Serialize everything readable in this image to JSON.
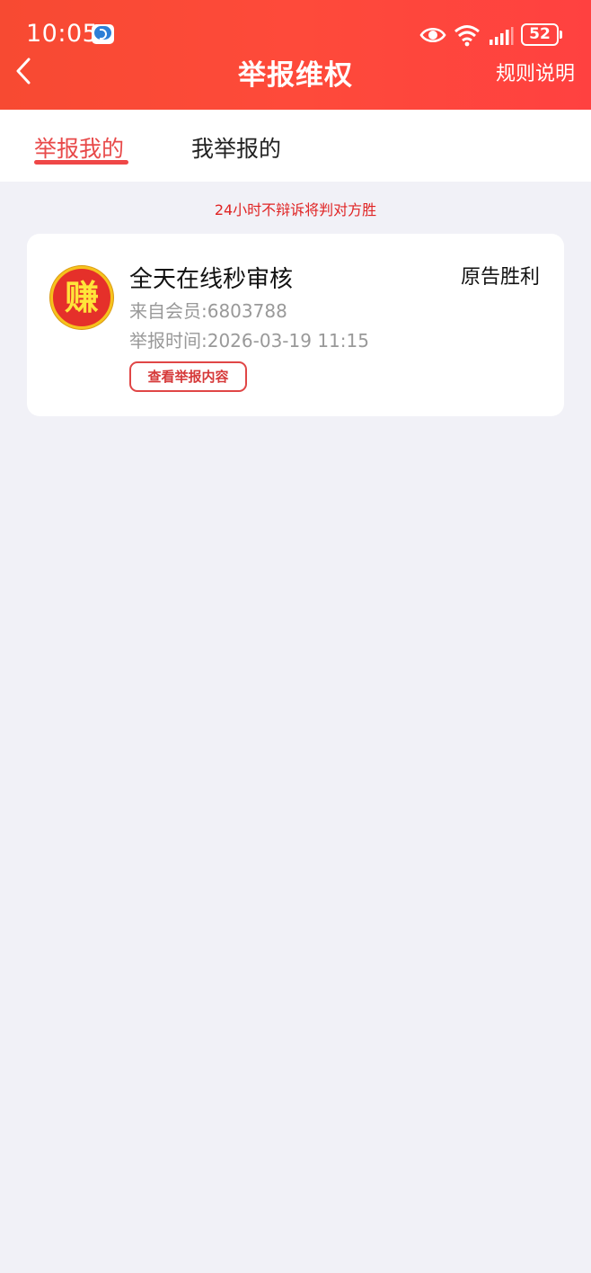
{
  "status_bar": {
    "time": "10:05",
    "battery": "52",
    "icons": [
      "app-badge-icon",
      "eye-icon",
      "wifi-icon",
      "signal-icon",
      "battery-icon"
    ]
  },
  "header": {
    "title": "举报维权",
    "right_link": "规则说明",
    "back_icon": "chevron-left-icon",
    "gradient": [
      "#f74a32",
      "#ff4140"
    ]
  },
  "tabs": [
    {
      "label": "举报我的",
      "active": true
    },
    {
      "label": "我举报的",
      "active": false
    }
  ],
  "notice": "24小时不辩诉将判对方胜",
  "reports": [
    {
      "avatar_char": "赚",
      "title": "全天在线秒审核",
      "result": "原告胜利",
      "member": "来自会员:6803788",
      "time": "举报时间:2026-03-19 11:15",
      "button": "查看举报内容"
    }
  ],
  "colors": {
    "accent": "#ef4747",
    "background": "#f1f1f7",
    "notice": "#e02424"
  }
}
